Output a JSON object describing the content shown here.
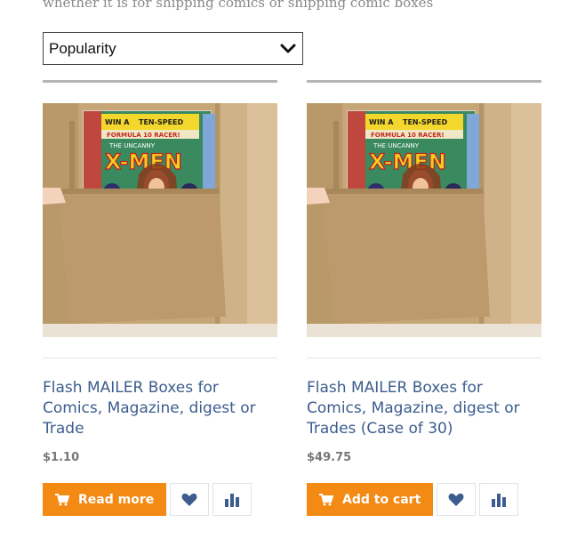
{
  "intro_text": "whether it is for shipping comics or shipping comic boxes",
  "sort": {
    "selected": "Popularity"
  },
  "products": [
    {
      "title": "Flash MAILER Boxes for Comics, Magazine, digest or Trade",
      "price": "$1.10",
      "button_label": "Read more",
      "button_icon": "cart-icon"
    },
    {
      "title": "Flash MAILER Boxes for Comics, Magazine, digest or Trades (Case of 30)",
      "price": "$49.75",
      "button_label": "Add to cart",
      "button_icon": "cart-icon"
    }
  ],
  "image_text": {
    "line1": "WIN A",
    "line2": "TEN-SPEED",
    "line3": "FORMULA 10 RACER!",
    "brand": "THE UNCANNY",
    "logo": "X-MEN"
  },
  "colors": {
    "accent": "#f38a13",
    "link": "#3c5d8e",
    "price": "#777777",
    "icon": "#3c5d8e"
  }
}
